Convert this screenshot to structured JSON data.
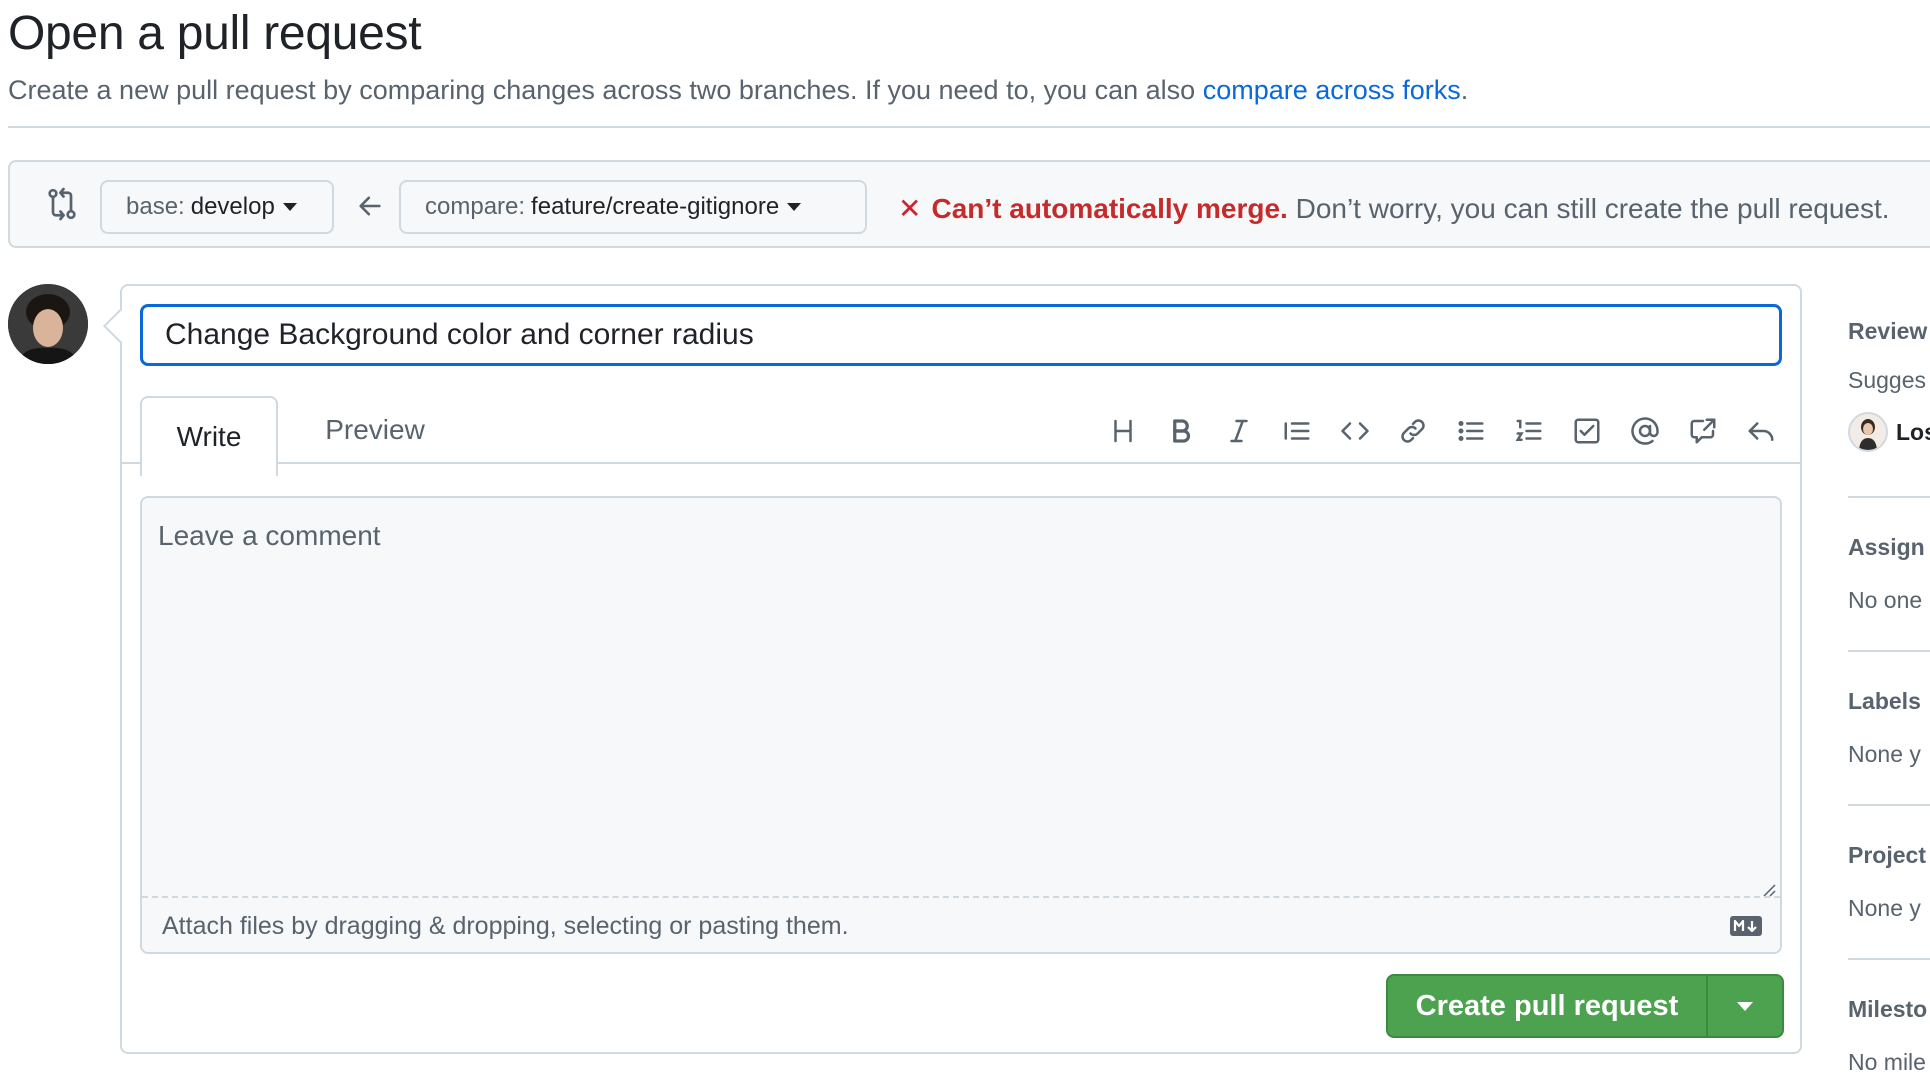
{
  "header": {
    "title": "Open a pull request",
    "subtitle_prefix": "Create a new pull request by comparing changes across two branches. If you need to, you can also ",
    "subtitle_link": "compare across forks",
    "subtitle_suffix": "."
  },
  "range": {
    "base_label": "base:",
    "base_branch": "develop",
    "compare_label": "compare:",
    "compare_branch": "feature/create-gitignore",
    "merge_x": "✕",
    "merge_status": "Can’t automatically merge.",
    "merge_note": " Don’t worry, you can still create the pull request."
  },
  "form": {
    "title_value": "Change Background color and corner radius",
    "tab_write": "Write",
    "tab_preview": "Preview",
    "comment_placeholder": "Leave a comment",
    "attach_text": "Attach files by dragging & dropping, selecting or pasting them.",
    "create_button": "Create pull request"
  },
  "toolbar_icons": [
    "heading-icon",
    "bold-icon",
    "italic-icon",
    "quote-icon",
    "code-icon",
    "link-icon",
    "unordered-list-icon",
    "ordered-list-icon",
    "task-list-icon",
    "mention-icon",
    "cross-reference-icon",
    "reply-icon"
  ],
  "sidebar": {
    "reviewers_head": "Review",
    "reviewers_note": "Sugges",
    "reviewer_name": "Los",
    "assignees_head": "Assign",
    "assignees_val": "No one",
    "labels_head": "Labels",
    "labels_val": "None y",
    "projects_head": "Project",
    "projects_val": "None y",
    "milestone_head": "Milesto",
    "milestone_val": "No mile"
  },
  "colors": {
    "accent": "#0969da",
    "danger": "#cf222e",
    "success": "#4da24f",
    "border": "#d1d9e0",
    "muted": "#59636e"
  }
}
